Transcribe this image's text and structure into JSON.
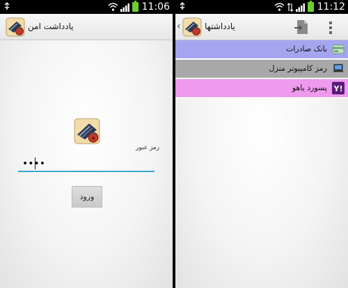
{
  "left_screen": {
    "status": {
      "time": "11:06"
    },
    "app_title": "یادداشت امن",
    "password_label": "رمز عبور",
    "password_value": "••••",
    "login_button": "ورود"
  },
  "right_screen": {
    "status": {
      "time": "11:12"
    },
    "title": "یادداشتها",
    "notes": [
      {
        "label": "بانک صادرات",
        "color": "#a5a5ef",
        "icon": "bank-card-icon"
      },
      {
        "label": "رمز کامپیوتر منزل",
        "color": "#a8a8a8",
        "icon": "laptop-icon"
      },
      {
        "label": "پسورد یاهو",
        "color": "#ee9aee",
        "icon": "yahoo-icon"
      }
    ]
  },
  "colors": {
    "input_underline": "#3aa7d6",
    "battery": "#6cd030"
  }
}
